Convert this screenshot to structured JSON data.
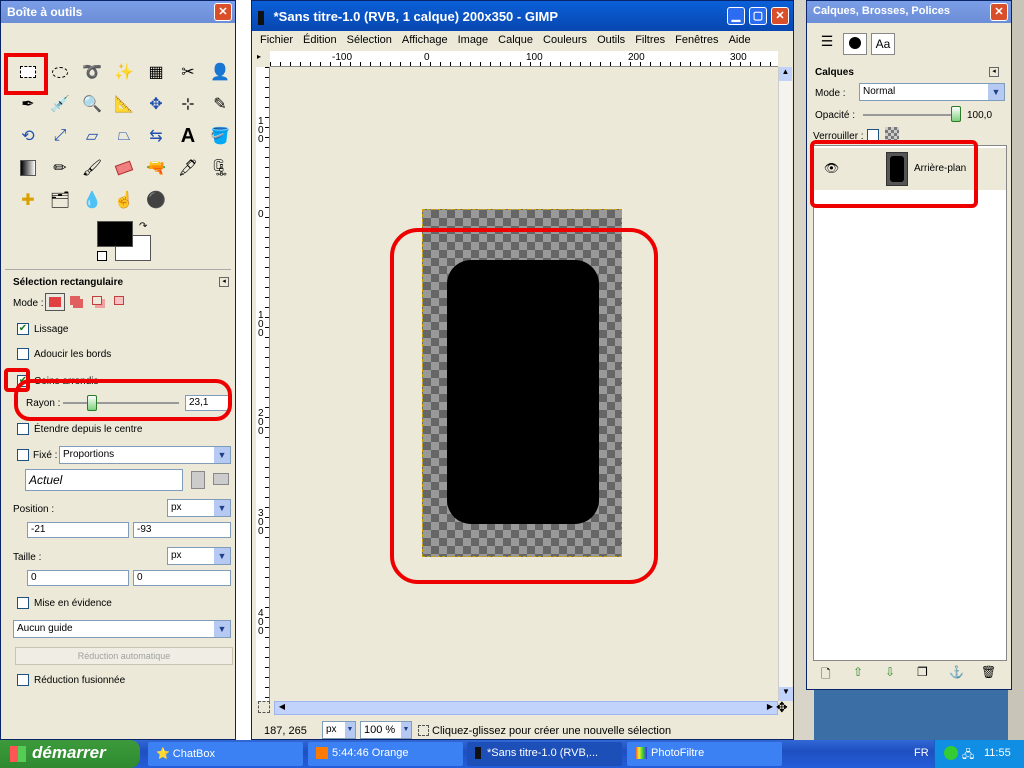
{
  "toolbox": {
    "title": "Boîte à outils",
    "tool_options_title": "Sélection rectangulaire",
    "mode_label": "Mode :",
    "lissage_label": "Lissage",
    "lissage_checked": true,
    "adoucir_label": "Adoucir les bords",
    "coins_label": "Coins arrondis",
    "coins_checked": true,
    "rayon_label": "Rayon :",
    "rayon_value": "23,1",
    "etendre_label": "Étendre depuis le centre",
    "fixe_label": "Fixé :",
    "fixe_option": "Proportions",
    "actuel_value": "Actuel",
    "position_label": "Position :",
    "position_unit": "px",
    "position_x": "-21",
    "position_y": "-93",
    "taille_label": "Taille :",
    "taille_unit": "px",
    "taille_w": "0",
    "taille_h": "0",
    "mise_label": "Mise en évidence",
    "guide_option": "Aucun guide",
    "reduction_auto": "Réduction automatique",
    "reduction_fusion": "Réduction fusionnée"
  },
  "image_window": {
    "title": "*Sans titre-1.0 (RVB, 1 calque) 200x350 - GIMP",
    "menu": [
      "Fichier",
      "Édition",
      "Sélection",
      "Affichage",
      "Image",
      "Calque",
      "Couleurs",
      "Outils",
      "Filtres",
      "Fenêtres",
      "Aide"
    ],
    "ruler_top": [
      "-100",
      "0",
      "100",
      "200",
      "300"
    ],
    "ruler_left": [
      "100",
      "0",
      "100",
      "200",
      "300",
      "400"
    ],
    "coords": "187, 265",
    "unit": "px",
    "zoom": "100 %",
    "status": "Cliquez-glissez pour créer une nouvelle sélection"
  },
  "layers": {
    "title": "Calques, Brosses, Polices",
    "panel_title": "Calques",
    "mode_label": "Mode :",
    "mode_value": "Normal",
    "opacity_label": "Opacité :",
    "opacity_value": "100,0",
    "lock_label": "Verrouiller :",
    "layer_name": "Arrière-plan"
  },
  "taskbar": {
    "start": "démarrer",
    "items": [
      "ChatBox",
      "5:44:46 Orange",
      "*Sans titre-1.0 (RVB,...",
      "PhotoFiltre"
    ],
    "lang": "FR",
    "clock": "11:55"
  },
  "colors": {
    "accent_red": "#ee0000",
    "xp_blue": "#0a5fd8",
    "panel_bg": "#ece9d8"
  }
}
